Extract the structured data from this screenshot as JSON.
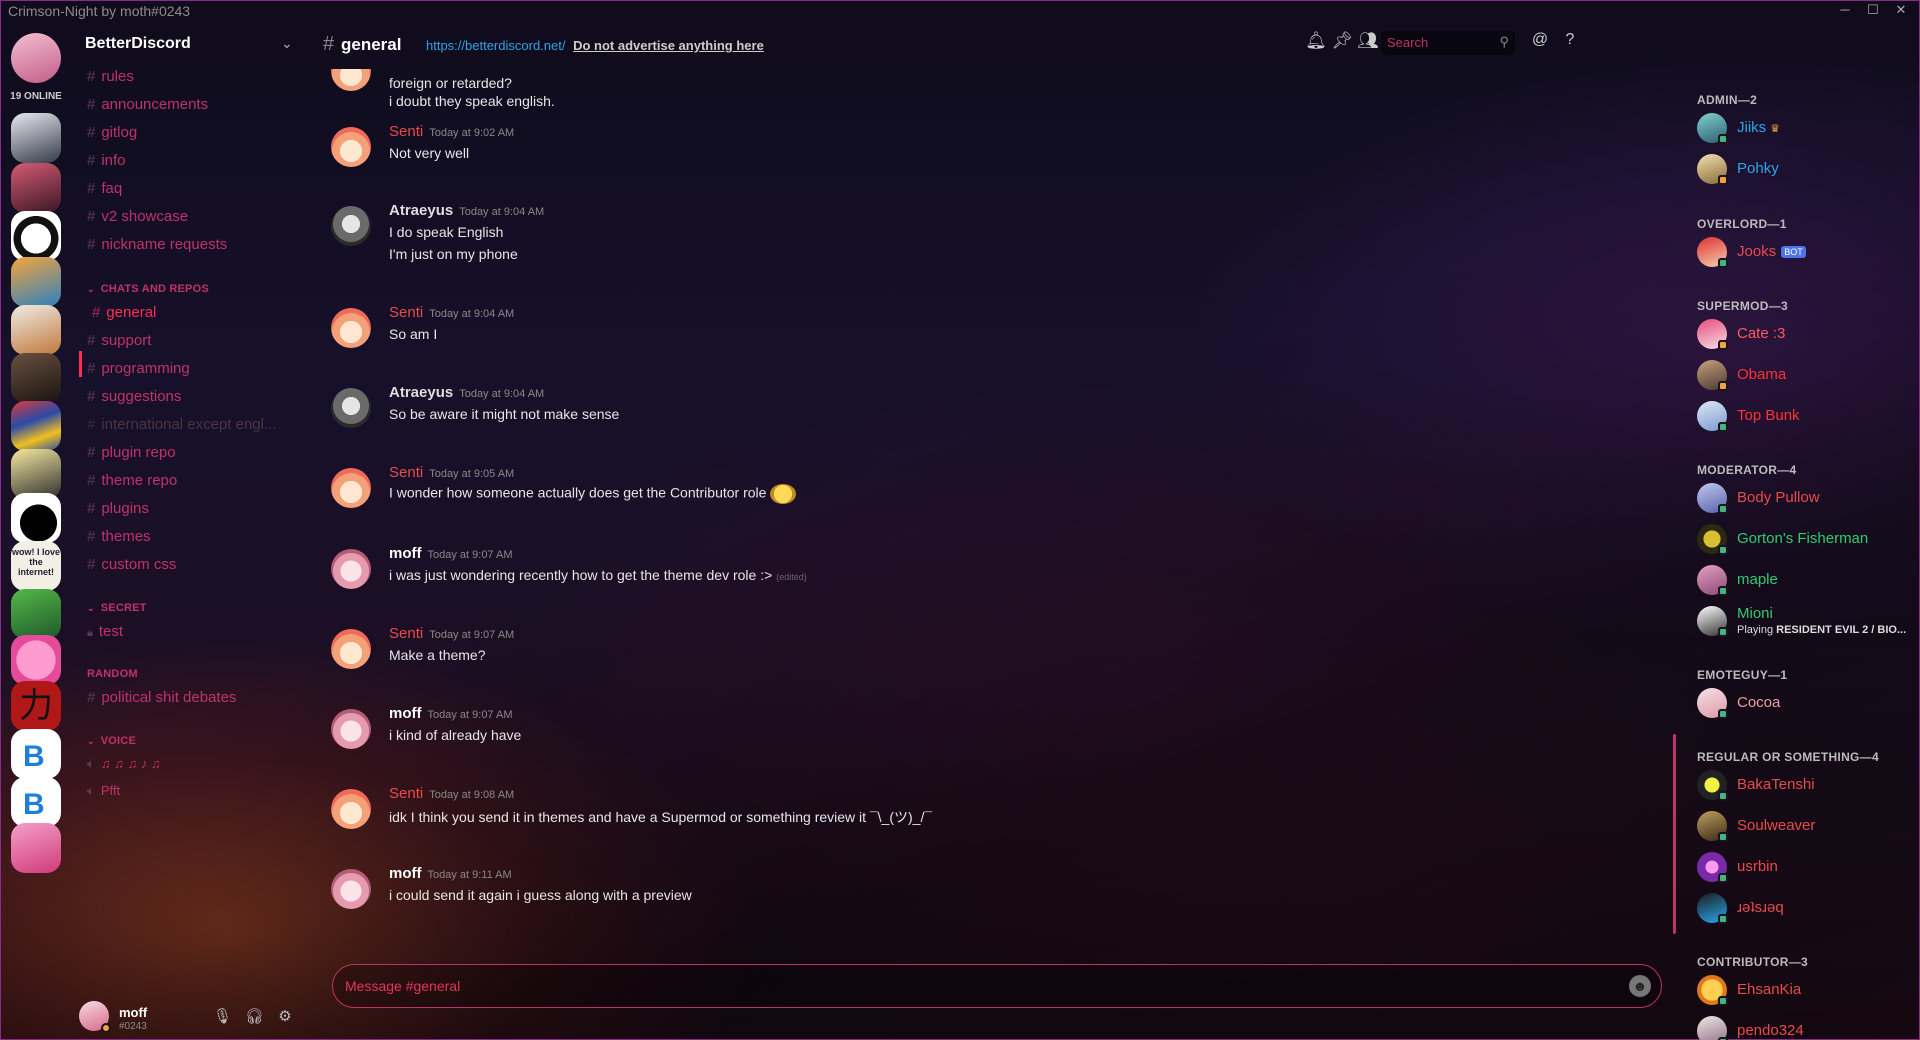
{
  "window": {
    "title": "Crimson-Night by moth#0243",
    "controls": [
      "─",
      "☐",
      "✕"
    ]
  },
  "guilds": {
    "online_count": "19 ONLINE",
    "icon_texts": [
      "wow! I love the internet!",
      "力"
    ]
  },
  "sidebar": {
    "server_name": "BetterDiscord",
    "channels_top": [
      "rules",
      "announcements",
      "gitlog",
      "info",
      "faq",
      "v2 showcase",
      "nickname requests"
    ],
    "cat_chats": "CHATS AND REPOS",
    "channels_chats": [
      "general",
      "support",
      "programming",
      "suggestions",
      "international except engl...",
      "plugin repo",
      "theme repo",
      "plugins",
      "themes",
      "custom css"
    ],
    "cat_secret": "SECRET",
    "channel_secret": "test",
    "cat_random": "RANDOM",
    "channel_random": "political shit debates",
    "cat_voice": "VOICE",
    "voice_channels": [
      "♫ ♫ ♫ ♪ ♫",
      "Pfft"
    ]
  },
  "user_panel": {
    "name": "moff",
    "tag": "#0243"
  },
  "header": {
    "channel": "general",
    "topic_link": "https://betterdiscord.net/",
    "topic_rule": "Do not advertise anything here",
    "search_placeholder": "Search"
  },
  "messages": [
    {
      "lines": [
        "foreign or retarded?",
        "i doubt they speak english."
      ]
    },
    {
      "author": "Senti",
      "time": "Today at 9:02 AM",
      "lines": [
        "Not very well"
      ]
    },
    {
      "author": "Atraeyus",
      "time": "Today at 9:04 AM",
      "lines": [
        "I do speak English",
        "I'm just on my phone"
      ]
    },
    {
      "author": "Senti",
      "time": "Today at 9:04 AM",
      "lines": [
        "So am I"
      ]
    },
    {
      "author": "Atraeyus",
      "time": "Today at 9:04 AM",
      "lines": [
        "So be aware it might not make sense"
      ]
    },
    {
      "author": "Senti",
      "time": "Today at 9:05 AM",
      "lines": [
        "I wonder how someone actually does get the Contributor role"
      ]
    },
    {
      "author": "moff",
      "time": "Today at 9:07 AM",
      "lines": [
        "i was just wondering recently how to get the theme dev role :>"
      ],
      "edited": "(edited)"
    },
    {
      "author": "Senti",
      "time": "Today at 9:07 AM",
      "lines": [
        "Make a theme?"
      ]
    },
    {
      "author": "moff",
      "time": "Today at 9:07 AM",
      "lines": [
        "i kind of already have"
      ]
    },
    {
      "author": "Senti",
      "time": "Today at 9:08 AM",
      "lines": [
        "idk I think you send it in themes and have a Supermod or something review it ¯\\_(ツ)_/¯"
      ]
    },
    {
      "author": "moff",
      "time": "Today at 9:11 AM",
      "lines": [
        "i could send it again i guess along with a preview"
      ]
    }
  ],
  "composer": {
    "placeholder": "Message #general"
  },
  "members": {
    "roles": [
      {
        "title": "ADMIN—2"
      },
      {
        "title": "OVERLORD—1"
      },
      {
        "title": "SUPERMOD—3"
      },
      {
        "title": "MODERATOR—4"
      },
      {
        "title": "EMOTEGUY—1"
      },
      {
        "title": "REGULAR OR SOMETHING—4"
      },
      {
        "title": "CONTRIBUTOR—3"
      }
    ],
    "list": [
      {
        "name": "Jiiks",
        "color": "#2fa3e8",
        "badge": "♛"
      },
      {
        "name": "Pohky",
        "color": "#2fa3e8"
      },
      {
        "name": "Jooks",
        "color": "#e84b4b",
        "badge": "BOT"
      },
      {
        "name": "Cate :3",
        "color": "#ff5a5a"
      },
      {
        "name": "Obama",
        "color": "#ff3333"
      },
      {
        "name": "Top Bunk",
        "color": "#ff3333"
      },
      {
        "name": "Body Pullow",
        "color": "#e84b4b"
      },
      {
        "name": "Gorton's Fisherman",
        "color": "#2ecc71"
      },
      {
        "name": "maple",
        "color": "#2ecc71"
      },
      {
        "name": "Mioni",
        "color": "#2ecc71",
        "activity_prefix": "Playing",
        "activity": "RESIDENT EVIL 2 / BIO..."
      },
      {
        "name": "Cocoa",
        "color": "#e8a0a0"
      },
      {
        "name": "BakaTenshi",
        "color": "#e84b4b"
      },
      {
        "name": "Soulweaver",
        "color": "#e84b4b"
      },
      {
        "name": "usrbin",
        "color": "#e84b4b"
      },
      {
        "name": "ɹǝʇsɹǝq",
        "color": "#e84b4b"
      },
      {
        "name": "EhsanKia",
        "color": "#e84b4b"
      },
      {
        "name": "pendo324",
        "color": "#e84b4b"
      }
    ]
  },
  "colors": {
    "accent": "#ff2d55",
    "channel": "#c0326a",
    "online": "#43b581",
    "idle": "#f2a33a",
    "link": "#2fa3e8"
  }
}
